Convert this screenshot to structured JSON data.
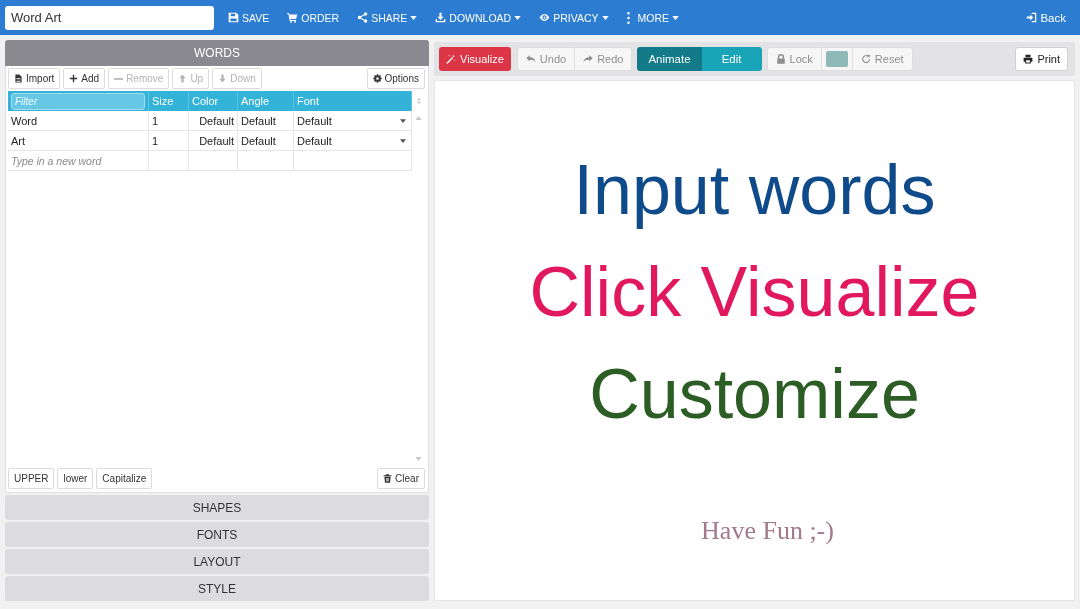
{
  "topbar": {
    "title": {
      "value": "Word Art"
    },
    "menu": [
      {
        "label": "SAVE",
        "dropdown": false
      },
      {
        "label": "ORDER",
        "dropdown": false
      },
      {
        "label": "SHARE",
        "dropdown": true
      },
      {
        "label": "DOWNLOAD",
        "dropdown": true
      },
      {
        "label": "PRIVACY",
        "dropdown": true
      },
      {
        "label": "MORE",
        "dropdown": true
      }
    ],
    "back": "Back"
  },
  "sections": [
    {
      "title": "WORDS",
      "expanded": true,
      "toolbar": [
        {
          "label": "Import",
          "disabled": false
        },
        {
          "label": "Add",
          "disabled": false
        },
        {
          "label": "Remove",
          "disabled": true
        },
        {
          "label": "Up",
          "disabled": true
        },
        {
          "label": "Down",
          "disabled": true
        }
      ],
      "options": "Options",
      "table": {
        "columns": [
          {
            "kind": "filter",
            "placeholder": "Filter"
          },
          {
            "kind": "label",
            "label": "Size"
          },
          {
            "kind": "label",
            "label": "Color"
          },
          {
            "kind": "label",
            "label": "Angle"
          },
          {
            "kind": "label",
            "label": "Font"
          }
        ],
        "rows": [
          {
            "cells": [
              "Word",
              "1",
              "Default",
              "Default",
              "Default"
            ]
          },
          {
            "cells": [
              "Art",
              "1",
              "Default",
              "Default",
              "Default"
            ]
          }
        ],
        "new_word": {
          "placeholder": "Type in a new word"
        }
      },
      "case_buttons": [
        "UPPER",
        "lower",
        "Capitalize"
      ],
      "clear": "Clear"
    },
    {
      "title": "SHAPES",
      "expanded": false
    },
    {
      "title": "FONTS",
      "expanded": false
    },
    {
      "title": "LAYOUT",
      "expanded": false
    },
    {
      "title": "STYLE",
      "expanded": false
    }
  ],
  "canvas_toolbar": {
    "visualize": "Visualize",
    "history": [
      {
        "label": "Undo",
        "disabled": true
      },
      {
        "label": "Redo",
        "disabled": true
      }
    ],
    "modes": [
      {
        "label": "Animate",
        "selected": true
      },
      {
        "label": "Edit",
        "selected": false
      }
    ],
    "lock": {
      "label": "Lock",
      "disabled": true
    },
    "swatch": {
      "color": "#8fb9b9"
    },
    "reset": {
      "label": "Reset",
      "disabled": true
    },
    "print": "Print"
  },
  "canvas": {
    "lines": [
      {
        "text": "Input words",
        "kind": "headline",
        "color": "#0f4a8a"
      },
      {
        "text": "Click Visualize",
        "kind": "headline",
        "color": "#e2185f"
      },
      {
        "text": "Customize",
        "kind": "headline",
        "color": "#2b5d25"
      },
      {
        "text": "Have Fun ;-)",
        "kind": "note",
        "color": "#a27a8b"
      }
    ]
  }
}
